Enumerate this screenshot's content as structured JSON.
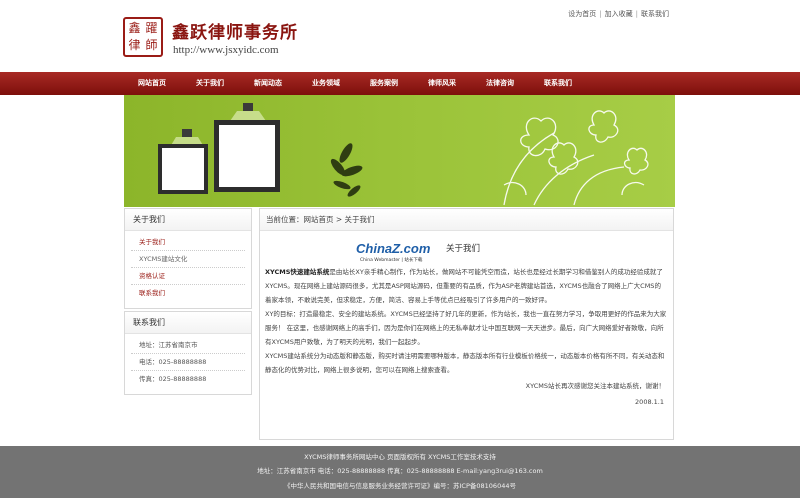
{
  "header": {
    "logo_text": [
      "鑫",
      "躍",
      "律",
      "師"
    ],
    "site_name": "鑫跃律师事务所",
    "site_url": "http://www.jsxyidc.com",
    "top_links": [
      "设为首页",
      "加入收藏",
      "联系我们"
    ]
  },
  "nav": {
    "items": [
      "网站首页",
      "关于我们",
      "新闻动态",
      "业务领域",
      "服务案例",
      "律师风采",
      "法律咨询",
      "联系我们"
    ]
  },
  "sidebar": {
    "about_title": "关于我们",
    "about_items": [
      "关于我们",
      "XYCMS建站文化",
      "资格认证",
      "联系我们"
    ],
    "contact_title": "联系我们",
    "contact_items": [
      "地址：江苏省南京市",
      "电话：025-88888888",
      "传真：025-88888888"
    ]
  },
  "main": {
    "breadcrumb": "当前位置：网站首页 > 关于我们",
    "watermark_brand": "ChinaZ.com",
    "watermark_sub": "China Webmaster | 站长下载",
    "article_title": "关于我们",
    "lead_bold": "XYCMS快速建站系统",
    "para1_rest": "是由站长XY亲手精心制作，作为站长，做网站不可能凭空而造，站长也是经过长期学习和借鉴别人的成功经验成就了XYCMS。现在网络上建站源码很多，尤其是ASP网站源码，但重要的有品质，作为ASP老牌建站首选，XYCMS也融合了网络上广大CMS的着家本领，不敢说完美，但求稳定，方便，简洁、容易上手等优点已经吸引了许多用户的一致好评。",
    "para2": "XY的目标：打造最稳定、安全的建站系统。XYCMS已经坚持了好几年的更新，作为站长，我也一直在努力学习，争取用更好的作品来为大家服务！ 在这里，也感谢网络上的高手们，因为是你们在网络上的无私奉献才让中国互联网一天天进步。最后，向广大网络爱好者致敬，向所有XYCMS用户致敬，为了明天的光明，我们一起起步。",
    "para3": "XYCMS建站系统分为动态版和静态版，购买时请注明需要哪种版本，静态版本所有行业模板价格统一，动态版本价格有所不同，有关动态和静态化的优势对比，网络上很多说明，您可以在网络上搜索查看。",
    "sign": "XYCMS站长再次感谢您关注本建站系统，谢谢！",
    "date": "2008.1.1"
  },
  "footer": {
    "line1": "XYCMS律师事务所网站中心  页面版权所有  XYCMS工作室技术支持",
    "line2": "地址：江苏省南京市    电话：025-88888888    传真：025-88888888    E-mail:yang3rui@163.com",
    "line3": "《中华人民共和国电信与信息服务业务经营许可证》编号：苏ICP备08106044号"
  },
  "colors": {
    "brand_red": "#8a1510",
    "nav_red": "#9a1c16",
    "banner_green": "#9cc43a",
    "footer_grey": "#737373",
    "watermark_blue": "#1f5fa8"
  }
}
